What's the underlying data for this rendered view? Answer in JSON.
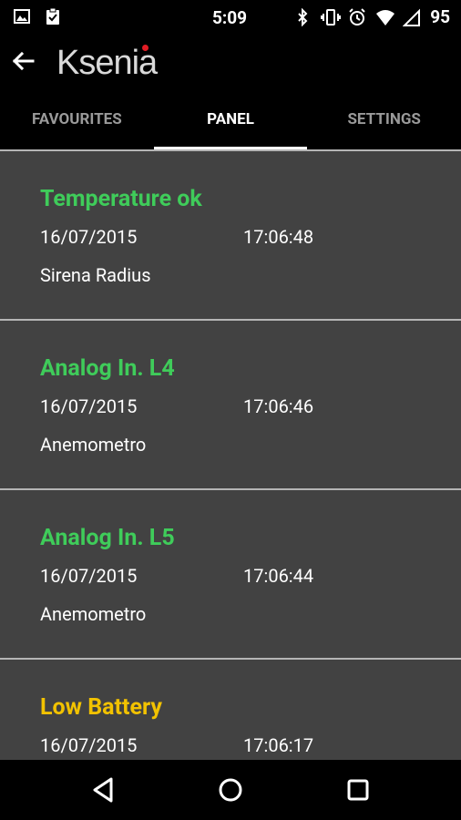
{
  "status_bar": {
    "time": "5:09",
    "battery": "95",
    "left_icons": [
      "image-icon",
      "clipboard-check-icon"
    ],
    "right_icons": [
      "bluetooth-icon",
      "vibrate-icon",
      "alarm-icon",
      "wifi-icon",
      "signal-icon"
    ]
  },
  "appbar": {
    "logo_text": "Ksenia",
    "accent_color": "#e21c24"
  },
  "tabs": [
    {
      "label": "FAVOURITES",
      "active": false
    },
    {
      "label": "PANEL",
      "active": true
    },
    {
      "label": "SETTINGS",
      "active": false
    }
  ],
  "events": [
    {
      "title": "Temperature ok",
      "date": "16/07/2015",
      "time": "17:06:48",
      "source": "Sirena Radius",
      "color": "#3fcc5a"
    },
    {
      "title": "Analog In. L4",
      "date": "16/07/2015",
      "time": "17:06:46",
      "source": "Anemometro",
      "color": "#3fcc5a"
    },
    {
      "title": "Analog In. L5",
      "date": "16/07/2015",
      "time": "17:06:44",
      "source": "Anemometro",
      "color": "#3fcc5a"
    },
    {
      "title": "Low Battery",
      "date": "16/07/2015",
      "time": "17:06:17",
      "source": "",
      "color": "#f2c200"
    }
  ]
}
